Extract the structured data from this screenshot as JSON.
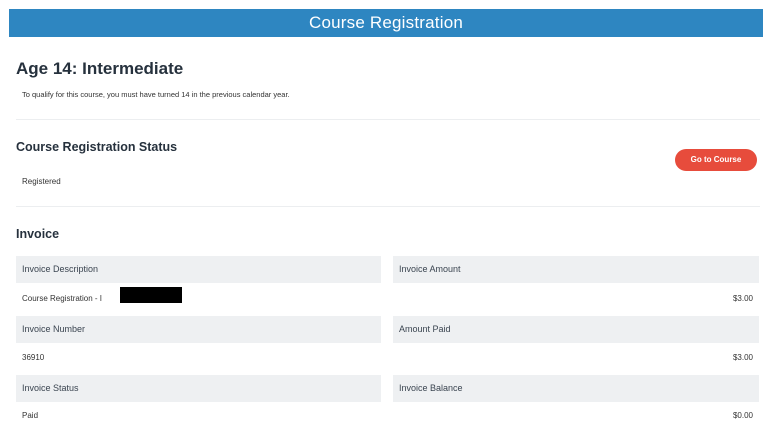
{
  "header": {
    "title": "Course Registration"
  },
  "course": {
    "title": "Age 14: Intermediate",
    "description": "To qualify for this course, you must have turned 14 in the previous calendar year."
  },
  "registration": {
    "heading": "Course Registration Status",
    "status": "Registered",
    "button_label": "Go to Course"
  },
  "invoice": {
    "heading": "Invoice",
    "description_label": "Invoice Description",
    "description_value": "Course Registration - I",
    "amount_label": "Invoice Amount",
    "amount_value": "$3.00",
    "number_label": "Invoice Number",
    "number_value": "36910",
    "paid_label": "Amount Paid",
    "paid_value": "$3.00",
    "status_label": "Invoice Status",
    "status_value": "Paid",
    "balance_label": "Invoice Balance",
    "balance_value": "$0.00"
  },
  "colors": {
    "header": "#2e86c1",
    "button": "#e74c3c",
    "label_bg": "#eef0f2"
  }
}
